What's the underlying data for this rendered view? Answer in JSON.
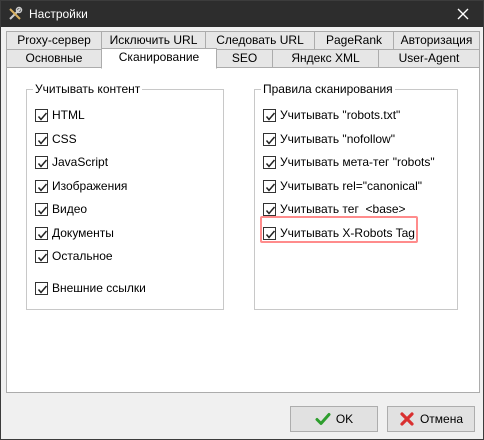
{
  "window": {
    "title": "Настройки"
  },
  "tabs": {
    "row1": [
      "Proxy-сервер",
      "Исключить URL",
      "Следовать URL",
      "PageRank",
      "Авторизация"
    ],
    "row2": [
      "Основные",
      "Сканирование",
      "SEO",
      "Яндекс XML",
      "User-Agent"
    ],
    "active": "Сканирование"
  },
  "content_group": {
    "title": "Учитывать контент",
    "items": [
      {
        "label": "HTML",
        "checked": true
      },
      {
        "label": "CSS",
        "checked": true
      },
      {
        "label": "JavaScript",
        "checked": true
      },
      {
        "label": "Изображения",
        "checked": true
      },
      {
        "label": "Видео",
        "checked": true
      },
      {
        "label": "Документы",
        "checked": true
      },
      {
        "label": "Остальное",
        "checked": true
      },
      {
        "label": "Внешние ссылки",
        "checked": true
      }
    ]
  },
  "rules_group": {
    "title": "Правила сканирования",
    "items": [
      {
        "label": "Учитывать \"robots.txt\"",
        "checked": true
      },
      {
        "label": "Учитывать \"nofollow\"",
        "checked": true
      },
      {
        "label": "Учитывать мета-тег \"robots\"",
        "checked": true
      },
      {
        "label": "Учитывать rel=\"canonical\"",
        "checked": true
      },
      {
        "label": "Учитывать тег  <base>",
        "checked": true
      },
      {
        "label": "Учитывать X-Robots Tag",
        "checked": true
      }
    ]
  },
  "buttons": {
    "ok": "OK",
    "cancel": "Отмена"
  },
  "colors": {
    "titlebar": "#2d2d2d",
    "highlight": "#ff8c8c",
    "ok_icon": "#2e9e2e",
    "cancel_icon": "#d93030"
  }
}
